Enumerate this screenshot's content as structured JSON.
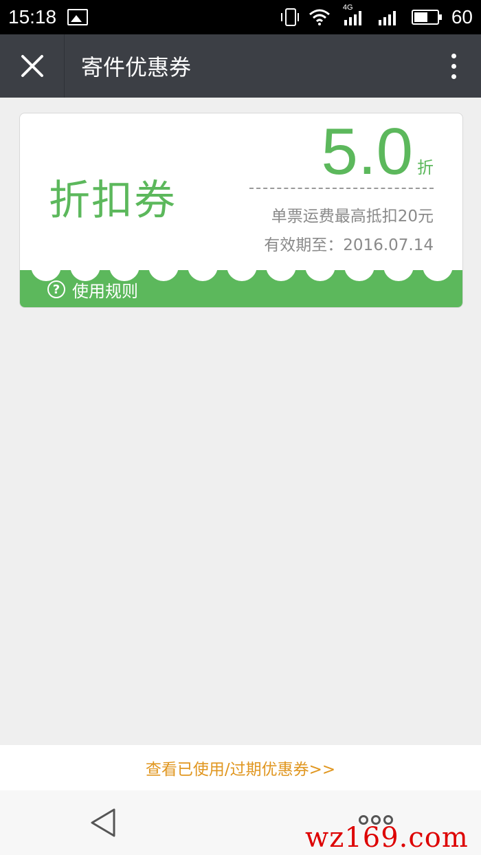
{
  "status_bar": {
    "time": "15:18",
    "network": "4G",
    "battery": "60",
    "icons": [
      "image-icon",
      "vibrate-icon",
      "wifi-icon",
      "signal-icon",
      "signal-icon",
      "battery-icon"
    ]
  },
  "nav": {
    "title": "寄件优惠券",
    "icons": [
      "close-icon",
      "more-icon"
    ]
  },
  "coupon": {
    "type_label": "折扣券",
    "value": "5.0",
    "unit": "折",
    "description": "单票运费最高抵扣20元",
    "expiry_label": "有效期至：",
    "expiry_date": "2016.07.14",
    "rules_label": "使用规则",
    "accent_color": "#5cb85c"
  },
  "footer": {
    "link_label": "查看已使用/过期优惠券>>",
    "link_color": "#e0961f"
  },
  "watermark": "wz169.com"
}
